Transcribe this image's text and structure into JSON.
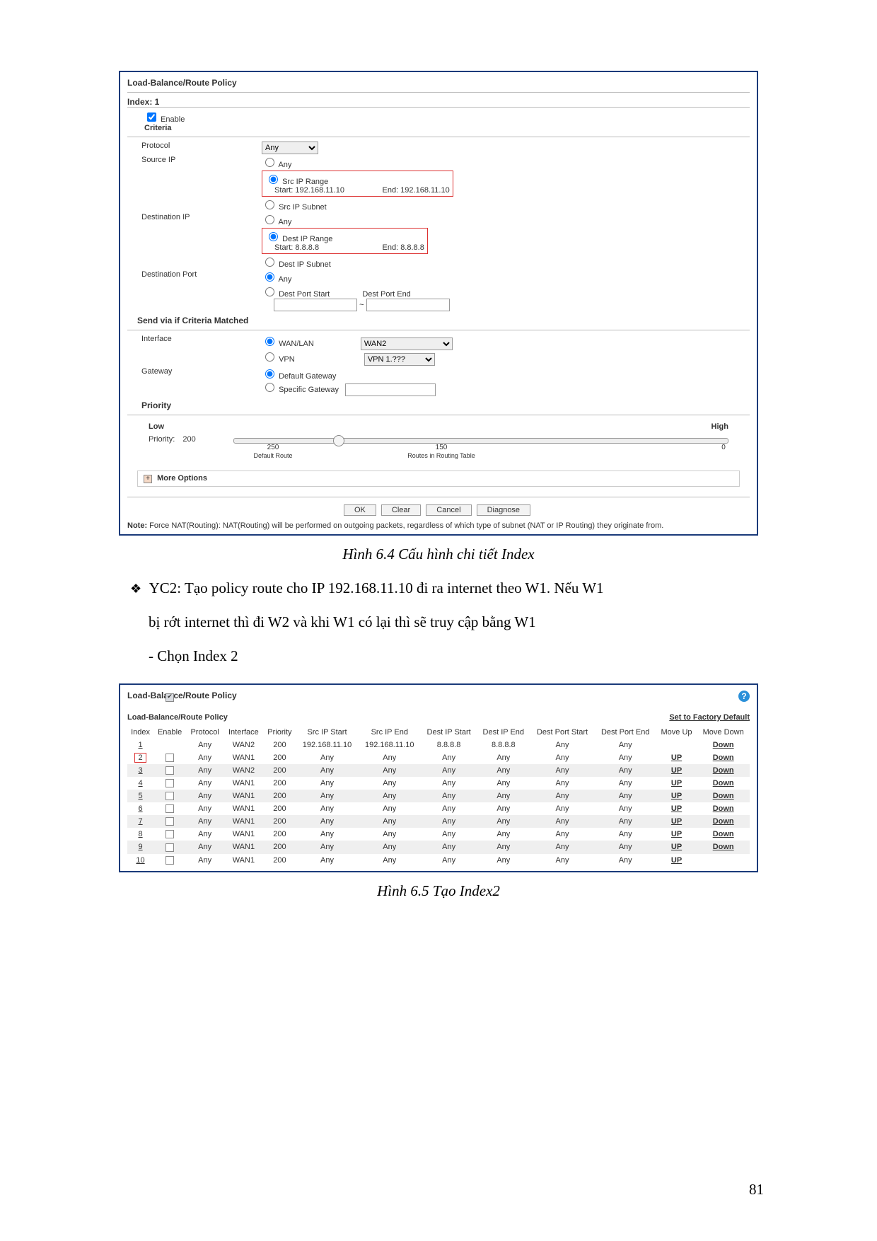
{
  "shot1": {
    "title": "Load-Balance/Route Policy",
    "index_label": "Index: 1",
    "enable": "Enable",
    "criteria": "Criteria",
    "proto_lbl": "Protocol",
    "proto_val": "Any",
    "src_lbl": "Source IP",
    "radio_any": "Any",
    "radio_src_range": "Src IP Range",
    "start_lbl": "Start:",
    "end_lbl": "End:",
    "src_start": "192.168.11.10",
    "src_end": "192.168.11.10",
    "radio_src_subnet": "Src IP Subnet",
    "dst_lbl": "Destination IP",
    "radio_dst_range": "Dest IP Range",
    "dst_start": "8.8.8.8",
    "dst_end": "8.8.8.8",
    "radio_dst_subnet": "Dest IP Subnet",
    "dport_lbl": "Destination Port",
    "radio_dport_start": "Dest Port Start",
    "radio_dport_end": "Dest Port End",
    "tilde": "~",
    "send_hdr": "Send via if Criteria Matched",
    "iface_lbl": "Interface",
    "wanlan": "WAN/LAN",
    "wan2": "WAN2",
    "vpn": "VPN",
    "vpn_val": "VPN 1.???",
    "gw_lbl": "Gateway",
    "gw_def": "Default Gateway",
    "gw_spec": "Specific Gateway",
    "prio_hdr": "Priority",
    "low": "Low",
    "high": "High",
    "prio_row": "Priority:",
    "prio_val": "200",
    "tick250": "250",
    "tickDef": "Default Route",
    "tick150": "150",
    "tickRoutes": "Routes in Routing Table",
    "tick0": "0",
    "more": "More Options",
    "btn_ok": "OK",
    "btn_clear": "Clear",
    "btn_cancel": "Cancel",
    "btn_diag": "Diagnose",
    "note_b": "Note:",
    "note_t": " Force NAT(Routing): NAT(Routing) will be performed on outgoing packets, regardless of which type of subnet (NAT or IP Routing) they originate from."
  },
  "caption1": "Hình 6.4 Cấu hình chi tiết Index",
  "para1a": "YC2: Tạo policy route cho IP 192.168.11.10 đi ra internet theo W1. Nếu W1",
  "para1b": "bị rớt internet thì đi W2 và khi W1 có lại thì sẽ truy cập bằng W1",
  "para2": "- Chọn Index 2",
  "shot2": {
    "title": "Load-Balance/Route Policy",
    "subtitle": "Load-Balance/Route Policy",
    "set_default": "Set to Factory Default",
    "cols": {
      "c0": "Index",
      "c1": "Enable",
      "c2": "Protocol",
      "c3": "Interface",
      "c4": "Priority",
      "c5": "Src IP Start",
      "c6": "Src IP End",
      "c7": "Dest IP\nStart",
      "c8": "Dest IP\nEnd",
      "c9": "Dest\nPort\nStart",
      "c10": "Dest\nPort\nEnd",
      "c11": "Move\nUp",
      "c12": "Move\nDown"
    },
    "rows": [
      {
        "i": "1",
        "en": true,
        "p": "Any",
        "if": "WAN2",
        "pr": "200",
        "ss": "192.168.11.10",
        "se": "192.168.11.10",
        "ds": "8.8.8.8",
        "de": "8.8.8.8",
        "ps": "Any",
        "pe": "Any",
        "up": "",
        "dn": "Down"
      },
      {
        "i": "2",
        "en": false,
        "hl": true,
        "p": "Any",
        "if": "WAN1",
        "pr": "200",
        "ss": "Any",
        "se": "Any",
        "ds": "Any",
        "de": "Any",
        "ps": "Any",
        "pe": "Any",
        "up": "UP",
        "dn": "Down"
      },
      {
        "i": "3",
        "en": false,
        "p": "Any",
        "if": "WAN2",
        "pr": "200",
        "ss": "Any",
        "se": "Any",
        "ds": "Any",
        "de": "Any",
        "ps": "Any",
        "pe": "Any",
        "up": "UP",
        "dn": "Down"
      },
      {
        "i": "4",
        "en": false,
        "p": "Any",
        "if": "WAN1",
        "pr": "200",
        "ss": "Any",
        "se": "Any",
        "ds": "Any",
        "de": "Any",
        "ps": "Any",
        "pe": "Any",
        "up": "UP",
        "dn": "Down"
      },
      {
        "i": "5",
        "en": false,
        "p": "Any",
        "if": "WAN1",
        "pr": "200",
        "ss": "Any",
        "se": "Any",
        "ds": "Any",
        "de": "Any",
        "ps": "Any",
        "pe": "Any",
        "up": "UP",
        "dn": "Down"
      },
      {
        "i": "6",
        "en": false,
        "p": "Any",
        "if": "WAN1",
        "pr": "200",
        "ss": "Any",
        "se": "Any",
        "ds": "Any",
        "de": "Any",
        "ps": "Any",
        "pe": "Any",
        "up": "UP",
        "dn": "Down"
      },
      {
        "i": "7",
        "en": false,
        "p": "Any",
        "if": "WAN1",
        "pr": "200",
        "ss": "Any",
        "se": "Any",
        "ds": "Any",
        "de": "Any",
        "ps": "Any",
        "pe": "Any",
        "up": "UP",
        "dn": "Down"
      },
      {
        "i": "8",
        "en": false,
        "p": "Any",
        "if": "WAN1",
        "pr": "200",
        "ss": "Any",
        "se": "Any",
        "ds": "Any",
        "de": "Any",
        "ps": "Any",
        "pe": "Any",
        "up": "UP",
        "dn": "Down"
      },
      {
        "i": "9",
        "en": false,
        "p": "Any",
        "if": "WAN1",
        "pr": "200",
        "ss": "Any",
        "se": "Any",
        "ds": "Any",
        "de": "Any",
        "ps": "Any",
        "pe": "Any",
        "up": "UP",
        "dn": "Down"
      },
      {
        "i": "10",
        "en": false,
        "p": "Any",
        "if": "WAN1",
        "pr": "200",
        "ss": "Any",
        "se": "Any",
        "ds": "Any",
        "de": "Any",
        "ps": "Any",
        "pe": "Any",
        "up": "UP",
        "dn": ""
      }
    ]
  },
  "caption2": "Hình 6.5 Tạo Index2",
  "page_number": "81"
}
